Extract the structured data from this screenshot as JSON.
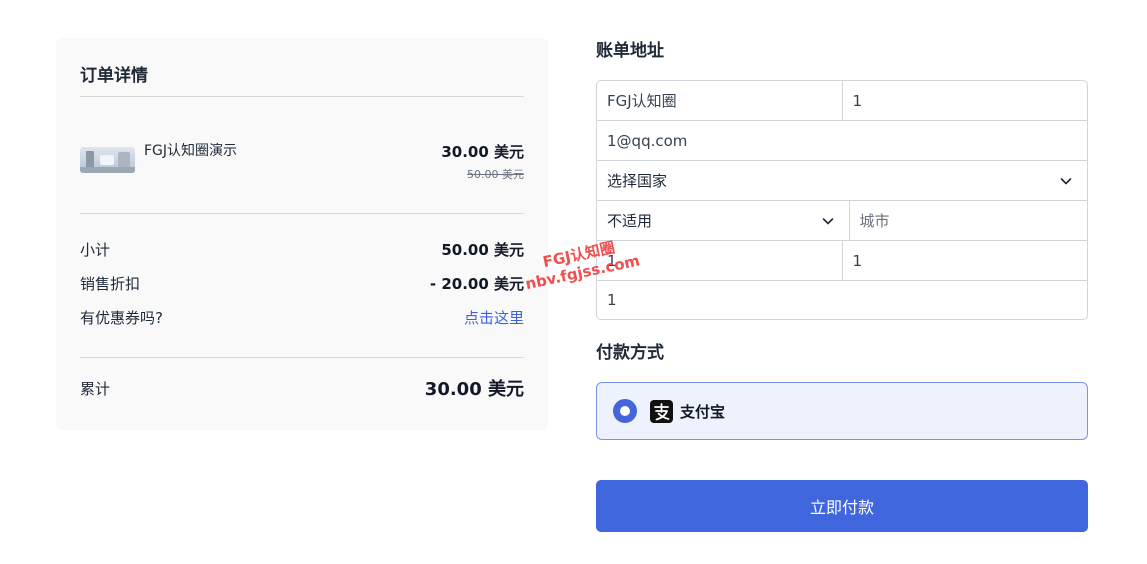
{
  "order": {
    "title": "订单详情",
    "product": {
      "name": "FGJ认知圈演示",
      "price": "30.00 美元",
      "original_price": "50.00 美元"
    },
    "subtotal": {
      "label": "小计",
      "value": "50.00 美元"
    },
    "discount": {
      "label": "销售折扣",
      "value": "- 20.00 美元"
    },
    "coupon": {
      "label": "有优惠券吗?",
      "link": "点击这里"
    },
    "total": {
      "label": "累计",
      "value": "30.00 美元"
    }
  },
  "billing": {
    "title": "账单地址",
    "name_value": "FGJ认知圈",
    "field2_value": "1",
    "email_value": "1@qq.com",
    "country_select": "选择国家",
    "state_select": "不适用",
    "city_placeholder": "城市",
    "field_a_value": "1",
    "field_b_value": "1",
    "field_c_value": "1"
  },
  "payment": {
    "title": "付款方式",
    "method": "支付宝",
    "method_icon": "alipay-icon",
    "accent": "#4066de"
  },
  "submit_label": "立即付款",
  "watermark": {
    "line1": "FGJ认知圈",
    "line2": "nbv.fgjss.com"
  }
}
